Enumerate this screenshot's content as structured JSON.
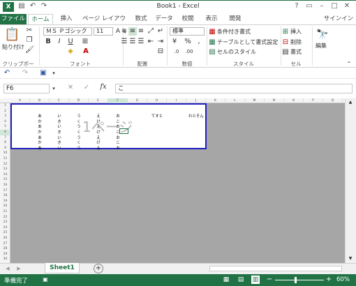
{
  "window": {
    "title": "Book1 - Excel",
    "app_icon": "X",
    "help": "?",
    "user": "サインイン"
  },
  "tabs": [
    "ファイル",
    "ホーム",
    "挿入",
    "ページ レイアウト",
    "数式",
    "データ",
    "校閲",
    "表示",
    "開発"
  ],
  "ribbon": {
    "clipboard": {
      "paste": "貼り付け",
      "label": "クリップボード"
    },
    "font": {
      "name": "ＭＳ Ｐゴシック",
      "size": "11",
      "bold": "B",
      "italic": "I",
      "underline": "U",
      "grow": "A",
      "shrink": "A",
      "label": "フォント"
    },
    "alignment": {
      "label": "配置"
    },
    "number": {
      "format": "標準",
      "percent": "%",
      "comma": ",",
      "label": "数値"
    },
    "styles": {
      "conditional": "条件付き書式",
      "table": "テーブルとして書式設定",
      "cell": "セルのスタイル",
      "label": "スタイル"
    },
    "cells": {
      "insert": "挿入",
      "delete": "削除",
      "format": "書式",
      "label": "セル"
    },
    "editing": {
      "label": "編集"
    }
  },
  "formula_bar": {
    "name_box": "F6",
    "fx": "fx",
    "value": "こ"
  },
  "columns": [
    "A",
    "B",
    "C",
    "D",
    "E",
    "F",
    "G",
    "H",
    "I",
    "J",
    "K",
    "L",
    "M",
    "N",
    "O",
    "P",
    "Q"
  ],
  "rows": [
    "1",
    "2",
    "3",
    "4",
    "5",
    "6",
    "7",
    "8",
    "9",
    "10",
    "11",
    "12",
    "13",
    "14",
    "15",
    "16",
    "17",
    "18",
    "19",
    "20",
    "21",
    "22",
    "23",
    "24",
    "25",
    "26",
    "27",
    "28",
    "29",
    "30"
  ],
  "cells": [
    {
      "col": "B",
      "row": 3,
      "v": "あ"
    },
    {
      "col": "C",
      "row": 3,
      "v": "い"
    },
    {
      "col": "D",
      "row": 3,
      "v": "う"
    },
    {
      "col": "E",
      "row": 3,
      "v": "え"
    },
    {
      "col": "F",
      "row": 3,
      "v": "お"
    },
    {
      "col": "H",
      "row": 3,
      "v": "てすと"
    },
    {
      "col": "J",
      "row": 3,
      "v": "わとそん"
    },
    {
      "col": "B",
      "row": 4,
      "v": "か"
    },
    {
      "col": "C",
      "row": 4,
      "v": "き"
    },
    {
      "col": "D",
      "row": 4,
      "v": "く"
    },
    {
      "col": "E",
      "row": 4,
      "v": "け"
    },
    {
      "col": "F",
      "row": 4,
      "v": "こ"
    },
    {
      "col": "B",
      "row": 5,
      "v": "あ"
    },
    {
      "col": "C",
      "row": 5,
      "v": "い"
    },
    {
      "col": "D",
      "row": 5,
      "v": "う"
    },
    {
      "col": "E",
      "row": 5,
      "v": "え"
    },
    {
      "col": "F",
      "row": 5,
      "v": "お"
    },
    {
      "col": "B",
      "row": 6,
      "v": "か"
    },
    {
      "col": "C",
      "row": 6,
      "v": "き"
    },
    {
      "col": "D",
      "row": 6,
      "v": "く"
    },
    {
      "col": "E",
      "row": 6,
      "v": "け"
    },
    {
      "col": "F",
      "row": 6,
      "v": "こ"
    },
    {
      "col": "B",
      "row": 7,
      "v": "あ"
    },
    {
      "col": "C",
      "row": 7,
      "v": "い"
    },
    {
      "col": "D",
      "row": 7,
      "v": "う"
    },
    {
      "col": "E",
      "row": 7,
      "v": "え"
    },
    {
      "col": "F",
      "row": 7,
      "v": "お"
    },
    {
      "col": "B",
      "row": 8,
      "v": "か"
    },
    {
      "col": "C",
      "row": 8,
      "v": "き"
    },
    {
      "col": "D",
      "row": 8,
      "v": "く"
    },
    {
      "col": "E",
      "row": 8,
      "v": "け"
    },
    {
      "col": "F",
      "row": 8,
      "v": "こ"
    },
    {
      "col": "B",
      "row": 9,
      "v": "あ"
    },
    {
      "col": "C",
      "row": 9,
      "v": "い"
    },
    {
      "col": "D",
      "row": 9,
      "v": "う"
    },
    {
      "col": "E",
      "row": 9,
      "v": "え"
    },
    {
      "col": "F",
      "row": 9,
      "v": "お"
    }
  ],
  "page_watermark": "1ページ",
  "sheet": {
    "name": "Sheet1",
    "add": "+"
  },
  "status": {
    "ready": "準備完了",
    "zoom": "60%",
    "minus": "−",
    "plus": "+"
  },
  "colors": {
    "accent": "#217346",
    "print_area": "#2020c0",
    "grid_bg": "#a6a6a6"
  }
}
